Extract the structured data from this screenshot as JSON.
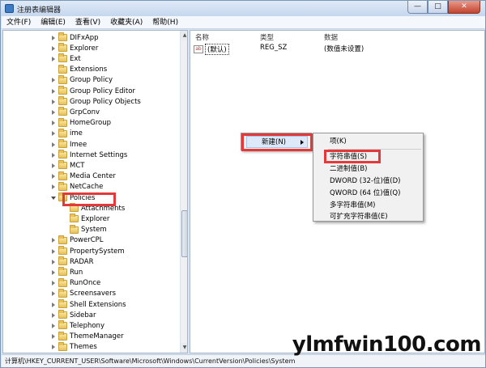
{
  "window": {
    "title": "注册表编辑器",
    "minimize_glyph": "—",
    "maximize_glyph": "□",
    "close_glyph": "✕"
  },
  "menubar": [
    "文件(F)",
    "编辑(E)",
    "查看(V)",
    "收藏夹(A)",
    "帮助(H)"
  ],
  "tree": {
    "items": [
      {
        "label": "DIFxApp",
        "expander": "collapsed"
      },
      {
        "label": "Explorer",
        "expander": "collapsed"
      },
      {
        "label": "Ext",
        "expander": "collapsed"
      },
      {
        "label": "Extensions",
        "expander": "none"
      },
      {
        "label": "Group Policy",
        "expander": "collapsed"
      },
      {
        "label": "Group Policy Editor",
        "expander": "collapsed"
      },
      {
        "label": "Group Policy Objects",
        "expander": "collapsed"
      },
      {
        "label": "GrpConv",
        "expander": "collapsed"
      },
      {
        "label": "HomeGroup",
        "expander": "collapsed"
      },
      {
        "label": "ime",
        "expander": "collapsed"
      },
      {
        "label": "Imee",
        "expander": "collapsed"
      },
      {
        "label": "Internet Settings",
        "expander": "collapsed"
      },
      {
        "label": "MCT",
        "expander": "collapsed"
      },
      {
        "label": "Media Center",
        "expander": "collapsed"
      },
      {
        "label": "NetCache",
        "expander": "collapsed"
      },
      {
        "label": "Policies",
        "expander": "expanded"
      },
      {
        "label": "Attachments",
        "expander": "none",
        "child": true
      },
      {
        "label": "Explorer",
        "expander": "none",
        "child": true
      },
      {
        "label": "System",
        "expander": "none",
        "child": true,
        "selected": true
      },
      {
        "label": "PowerCPL",
        "expander": "collapsed"
      },
      {
        "label": "PropertySystem",
        "expander": "collapsed"
      },
      {
        "label": "RADAR",
        "expander": "collapsed"
      },
      {
        "label": "Run",
        "expander": "collapsed"
      },
      {
        "label": "RunOnce",
        "expander": "collapsed"
      },
      {
        "label": "Screensavers",
        "expander": "collapsed"
      },
      {
        "label": "Shell Extensions",
        "expander": "collapsed"
      },
      {
        "label": "Sidebar",
        "expander": "collapsed"
      },
      {
        "label": "Telephony",
        "expander": "collapsed"
      },
      {
        "label": "ThemeManager",
        "expander": "collapsed"
      },
      {
        "label": "Themes",
        "expander": "collapsed"
      }
    ]
  },
  "list": {
    "headers": {
      "name": "名称",
      "type": "类型",
      "data": "数据"
    },
    "rows": [
      {
        "icon": "ab",
        "name": "(默认)",
        "type": "REG_SZ",
        "data": "(数值未设置)"
      }
    ]
  },
  "context_menu": {
    "new_label": "新建(N)",
    "submenu": {
      "key": "项(K)",
      "items": [
        "字符串值(S)",
        "二进制值(B)",
        "DWORD (32-位)值(D)",
        "QWORD (64 位)值(Q)",
        "多字符串值(M)",
        "可扩充字符串值(E)"
      ]
    }
  },
  "status": {
    "path": "计算机\\HKEY_CURRENT_USER\\Software\\Microsoft\\Windows\\CurrentVersion\\Policies\\System"
  },
  "watermark": {
    "text": "ylmfwin100.com"
  },
  "colors": {
    "highlight": "#e23a3a",
    "menu_hover": "#dde9f8"
  }
}
